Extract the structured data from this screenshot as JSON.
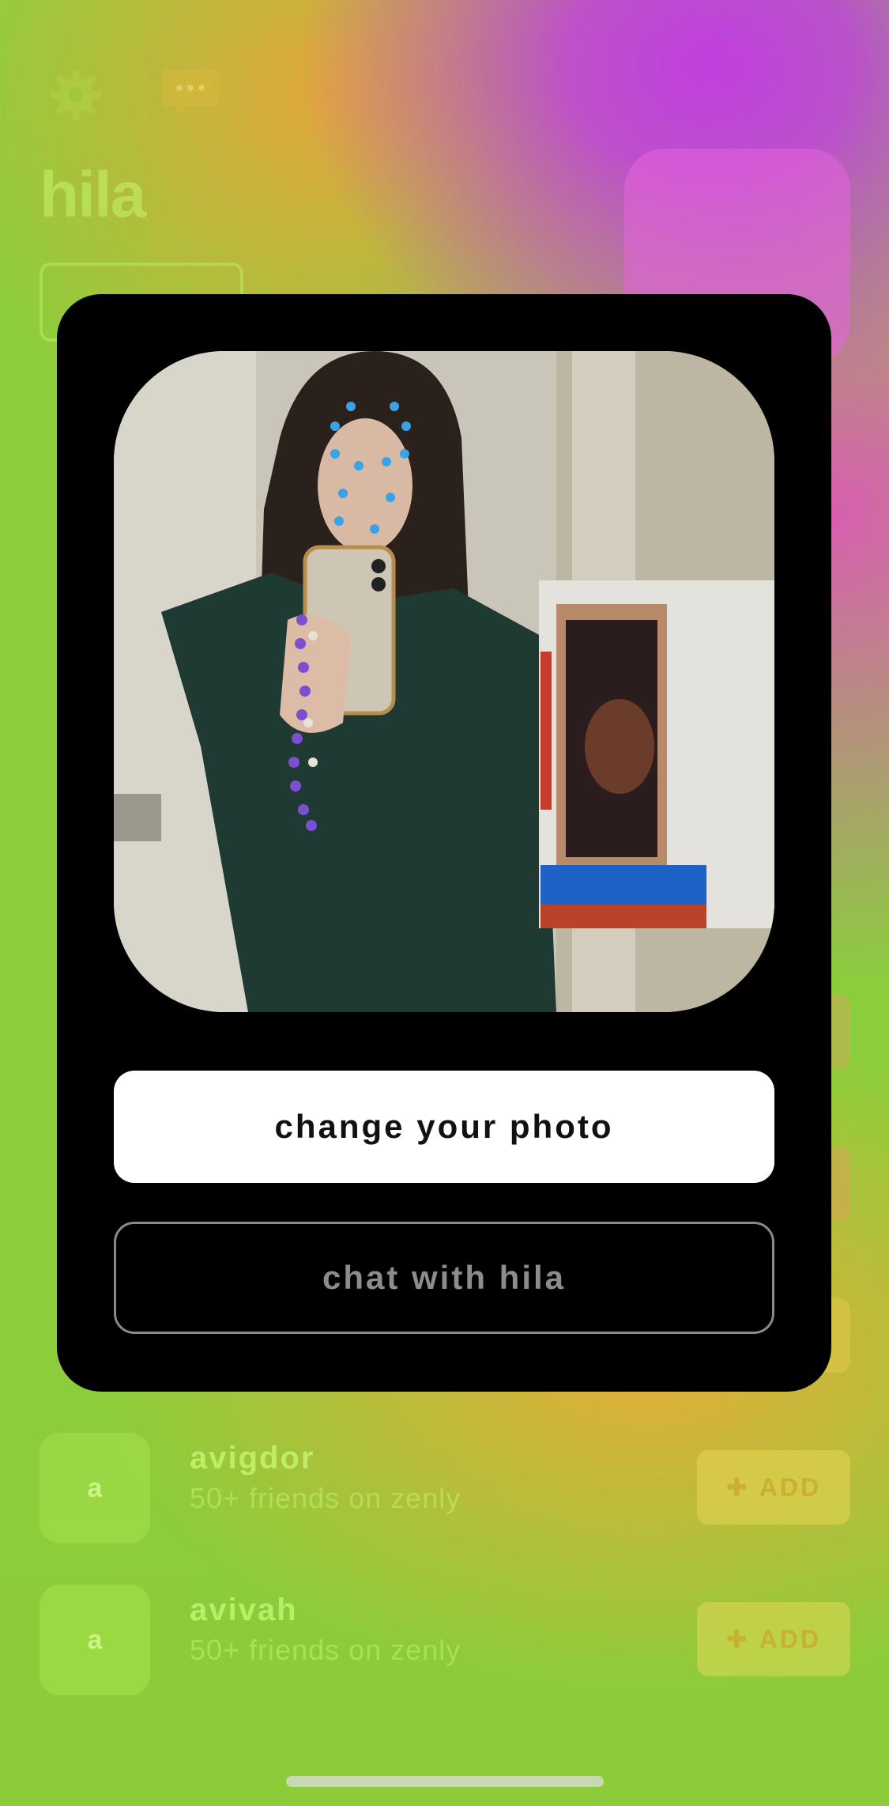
{
  "background": {
    "profile_name": "hila",
    "rows": [
      {
        "avatar_letter": "a",
        "name": "avigdor",
        "subtitle": "50+ friends on zenly",
        "add_label": "ADD"
      },
      {
        "avatar_letter": "a",
        "name": "avivah",
        "subtitle": "50+ friends on zenly",
        "add_label": "ADD"
      }
    ]
  },
  "modal": {
    "primary_button": "change your photo",
    "secondary_button": "chat with hila"
  },
  "colors": {
    "modal_bg": "#000000",
    "primary_button_bg": "#ffffff",
    "secondary_button_border": "#8a8a8a"
  }
}
